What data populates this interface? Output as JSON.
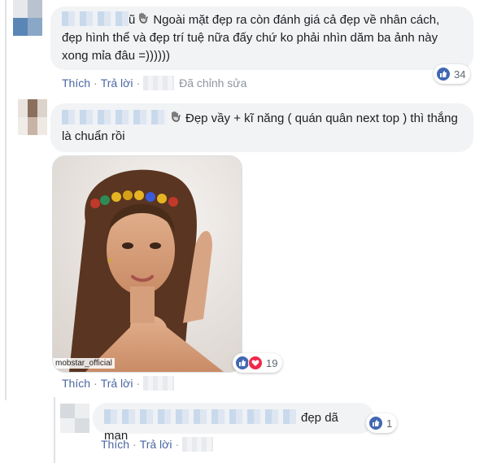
{
  "comments": [
    {
      "text": "Ngoài mặt đẹp ra còn đánh giá cả đẹp về nhân cách, đẹp hình thể và đẹp trí tuệ nữa đấy chứ ko phải nhìn dăm ba ảnh này xong mỉa đâu =))))))",
      "name_fragment": "ũ",
      "like_label": "Thích",
      "reply_label": "Trả lời",
      "edited_label": "Đã chỉnh sửa",
      "reaction_count": "34"
    },
    {
      "text": "Đẹp vầy + kĩ năng ( quán quân next top ) thì thắng là chuẩn rồi",
      "like_label": "Thích",
      "reply_label": "Trả lời",
      "reaction_count": "19",
      "photo_watermark": "mobstar_official"
    }
  ],
  "reply": {
    "text": "đẹp dã man",
    "like_label": "Thích",
    "reply_label": "Trả lời",
    "reaction_count": "1"
  },
  "colors": {
    "link": "#4b67a1",
    "like": "#4267b2",
    "love": "#f0284a",
    "bubble": "#f2f3f5"
  },
  "icons": [
    "wave-hand-icon",
    "like-reaction-icon",
    "love-reaction-icon"
  ]
}
